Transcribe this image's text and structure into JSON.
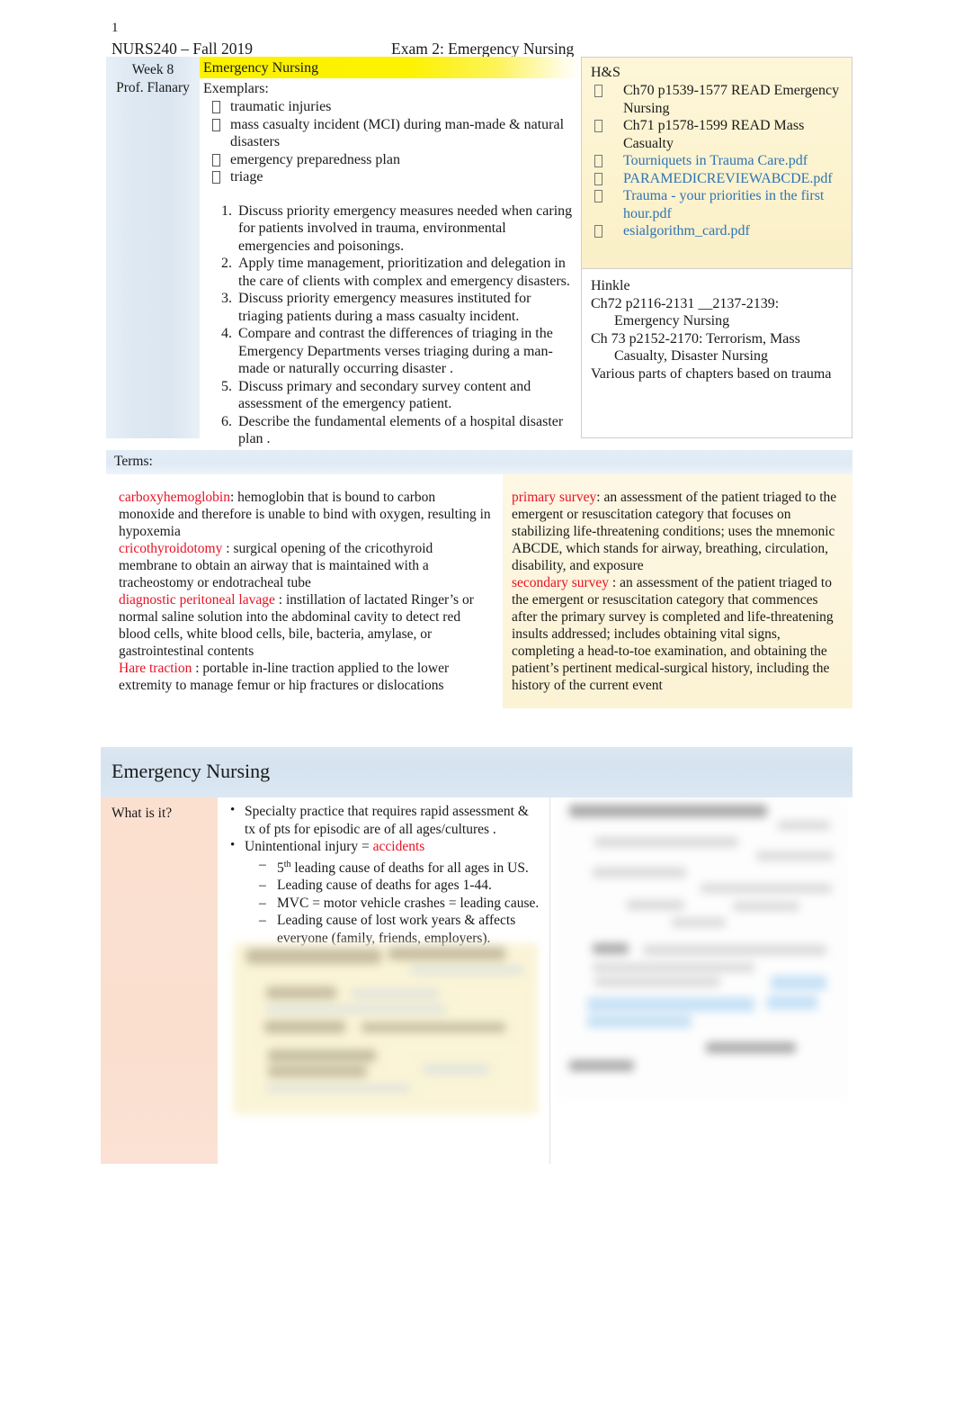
{
  "document": {
    "page_number": "1",
    "header_left": "NURS240 – Fall 2019",
    "header_right": "Exam 2: Emergency Nursing"
  },
  "colors": {
    "highlight_yellow": "#fcf200",
    "term_red": "#e81123",
    "link_blue": "#2e74b5",
    "panel_blue": "#dbe7f1",
    "panel_cream": "#fdf6d8",
    "panel_peach": "#fbe0d0"
  },
  "week_table": {
    "left_col": {
      "week": "Week 8",
      "professor": "Prof. Flanary"
    },
    "topic_highlight": "Emergency Nursing",
    "exemplars_label": "Exemplars:",
    "exemplars": [
      "traumatic injuries",
      "mass casualty incident (MCI) during man-made & natural disasters",
      "emergency preparedness plan",
      "triage"
    ],
    "objectives": [
      "Discuss priority emergency measures   needed when caring for patients involved in trauma, environmental emergencies and poisonings.",
      "Apply time management, prioritization and delegation    in the care of clients with complex and emergency disasters.",
      "Discuss priority emergency measures instituted for triaging patients  during a mass casualty incident.",
      "Compare and contrast the   differences of triaging in the Emergency Departments verses triaging during a man-made or naturally occurring disaster .",
      "Discuss primary and secondary survey content   and assessment of the emergency patient.",
      "Describe the  fundamental elements of a hospital disaster plan ."
    ],
    "readings": {
      "hs_title": "H&S",
      "hs_items": [
        {
          "text": "Ch70 p1539-1577 READ Emergency Nursing",
          "is_link": false
        },
        {
          "text": "Ch71 p1578-1599 READ Mass Casualty",
          "is_link": false
        },
        {
          "text": "Tourniquets in Trauma Care.pdf",
          "is_link": true
        },
        {
          "text": "PARAMEDICREVIEWABCDE.pdf",
          "is_link": true
        },
        {
          "text": "Trauma - your priorities in the first hour.pdf",
          "is_link": true
        },
        {
          "text": "esialgorithm_card.pdf",
          "is_link": true
        }
      ],
      "hinkle_title": "Hinkle",
      "hinkle_lines": [
        "Ch72 p2116-2131 __2137-2139:",
        "Emergency Nursing",
        "Ch 73 p2152-2170: Terrorism, Mass",
        "Casualty, Disaster Nursing",
        "Various parts of chapters based on trauma"
      ]
    }
  },
  "terms_section": {
    "header": "Terms:",
    "left_terms": [
      {
        "term": "carboxyhemoglobin",
        "separator": ": ",
        "definition": "hemoglobin that is bound to carbon monoxide and therefore is unable to bind with oxygen, resulting in hypoxemia"
      },
      {
        "term": "cricothyroidotomy",
        "separator": " : ",
        "definition": "surgical opening of the cricothyroid membrane to obtain an airway that is maintained with a tracheostomy or endotracheal tube"
      },
      {
        "term": "diagnostic peritoneal lavage",
        "separator": " : ",
        "definition": "instillation of lactated Ringer’s or normal saline solution into the abdominal cavity to detect red blood cells, white blood cells, bile, bacteria, amylase, or gastrointestinal contents"
      },
      {
        "term": "Hare traction",
        "separator": " : ",
        "definition": "portable in-line traction applied to the lower extremity to manage femur or hip fractures or dislocations"
      }
    ],
    "right_terms": [
      {
        "term": "primary survey",
        "separator": ": ",
        "definition": "an assessment of the patient triaged to the emergent or resuscitation category that focuses on stabilizing life-threatening conditions; uses the mnemonic ABCDE, which stands for airway, breathing, circulation, disability, and exposure"
      },
      {
        "term": "secondary survey",
        "separator": " : ",
        "definition": "an assessment of the patient triaged to the emergent or resuscitation category that commences after the primary survey is completed and life-threatening insults addressed; includes obtaining vital signs, completing a head-to-toe examination, and obtaining the patient’s pertinent medical-surgical history, including the history of the current event"
      }
    ]
  },
  "emergency_nursing_section": {
    "title": "Emergency Nursing",
    "row_label": "What is it?",
    "bullets": [
      {
        "text_before": "Specialty practice that requires rapid assessment & tx of pts for episodic are of all ages/cultures  .",
        "highlight": "",
        "text_after": "",
        "sub": []
      },
      {
        "text_before": "Unintentional injury  = ",
        "highlight": "accidents",
        "text_after": "",
        "sub": [
          {
            "prefix": "5",
            "sup": "th",
            "rest": " leading cause of deaths for all ages in US."
          },
          {
            "prefix": "",
            "sup": "",
            "rest": "Leading cause of deaths for ages 1-44."
          },
          {
            "prefix": "",
            "sup": "",
            "rest": "MVC = motor vehicle crashes = leading cause."
          },
          {
            "prefix": "",
            "sup": "",
            "rest": "Leading cause of lost work years & affects everyone (family, friends, employers)."
          }
        ]
      }
    ],
    "embedded_images": [
      {
        "name": "blurred-slide-thumbnail-cream",
        "description": ""
      },
      {
        "name": "blurred-document-thumbnail-white",
        "description": ""
      }
    ]
  }
}
